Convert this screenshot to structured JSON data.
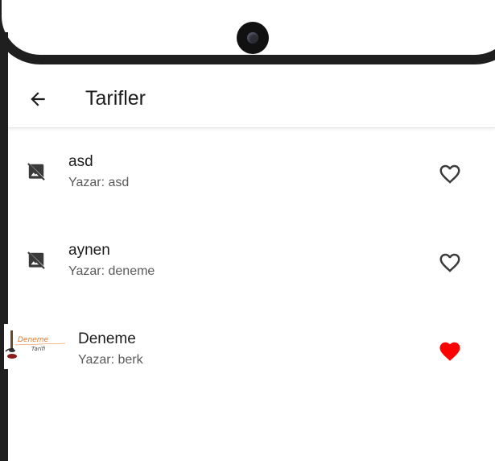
{
  "app_bar": {
    "title": "Tarifler",
    "back_icon": "arrow-left-icon"
  },
  "recipes": [
    {
      "name": "asd",
      "author": "Yazar: asd",
      "thumbnail": "image-not-supported-icon",
      "favorite": false
    },
    {
      "name": "aynen",
      "author": "Yazar: deneme",
      "thumbnail": "image-not-supported-icon",
      "favorite": false
    },
    {
      "name": "Deneme",
      "author": "Yazar: berk",
      "thumbnail": "recipe-photo",
      "favorite": true,
      "thumb_text_1": "Deneme",
      "thumb_text_2": "Tarifi"
    }
  ],
  "colors": {
    "favorite": "#ff0000",
    "heart_outline": "#3b3b3b",
    "text_primary": "#1d1d1d",
    "text_secondary": "#5a5a5a"
  }
}
